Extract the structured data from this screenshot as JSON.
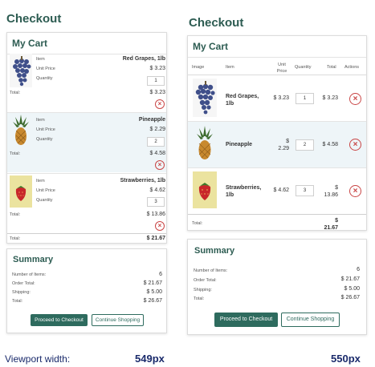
{
  "page_title": "Checkout",
  "cart": {
    "title": "My Cart",
    "columns": [
      "Image",
      "Item",
      "Unit Price",
      "Quantity",
      "Total",
      "Actions"
    ],
    "labels": {
      "item": "Item",
      "unit_price": "Unit Price",
      "quantity": "Quantity",
      "total": "Total:"
    },
    "items": [
      {
        "name": "Red Grapes, 1lb",
        "name_l1": "Red Grapes,",
        "name_l2": "1lb",
        "price": "$ 3.23",
        "price_l1": "$ 3.23",
        "price_l2": "",
        "qty": "1",
        "total": "$ 3.23",
        "total_l1": "$ 3.23",
        "total_l2": ""
      },
      {
        "name": "Pineapple",
        "name_l1": "Pineapple",
        "name_l2": "",
        "price": "$ 2.29",
        "price_l1": "$",
        "price_l2": "2.29",
        "qty": "2",
        "total": "$ 4.58",
        "total_l1": "$ 4.58",
        "total_l2": ""
      },
      {
        "name": "Strawberries, 1lb",
        "name_l1": "Strawberries,",
        "name_l2": "1lb",
        "price": "$ 4.62",
        "price_l1": "$ 4.62",
        "price_l2": "",
        "qty": "3",
        "total": "$ 13.86",
        "total_l1": "$",
        "total_l2": "13.86"
      }
    ],
    "grand_total_label": "Total:",
    "grand_total": "$ 21.67",
    "grand_total_l1": "$",
    "grand_total_l2": "21.67"
  },
  "summary": {
    "title": "Summary",
    "rows": [
      {
        "label": "Number of Items:",
        "value": "6"
      },
      {
        "label": "Order Total:",
        "value": "$ 21.67"
      },
      {
        "label": "Shipping:",
        "value": "$ 5.00"
      },
      {
        "label": "Total:",
        "value": "$ 26.67"
      }
    ],
    "checkout_label": "Proceed to Checkout",
    "continue_label": "Continue Shopping"
  },
  "viewport": {
    "label": "Viewport width:",
    "left_value": "549px",
    "right_value": "550px"
  },
  "colors": {
    "accent": "#2e6b5e",
    "heading": "#2d5c52",
    "remove": "#c94545",
    "row_alt": "#eef5f8",
    "viewport_text": "#1a2a6b"
  },
  "icons": {
    "remove": "close-icon",
    "grapes": "grapes-image",
    "pineapple": "pineapple-image",
    "strawberry": "strawberry-image"
  }
}
